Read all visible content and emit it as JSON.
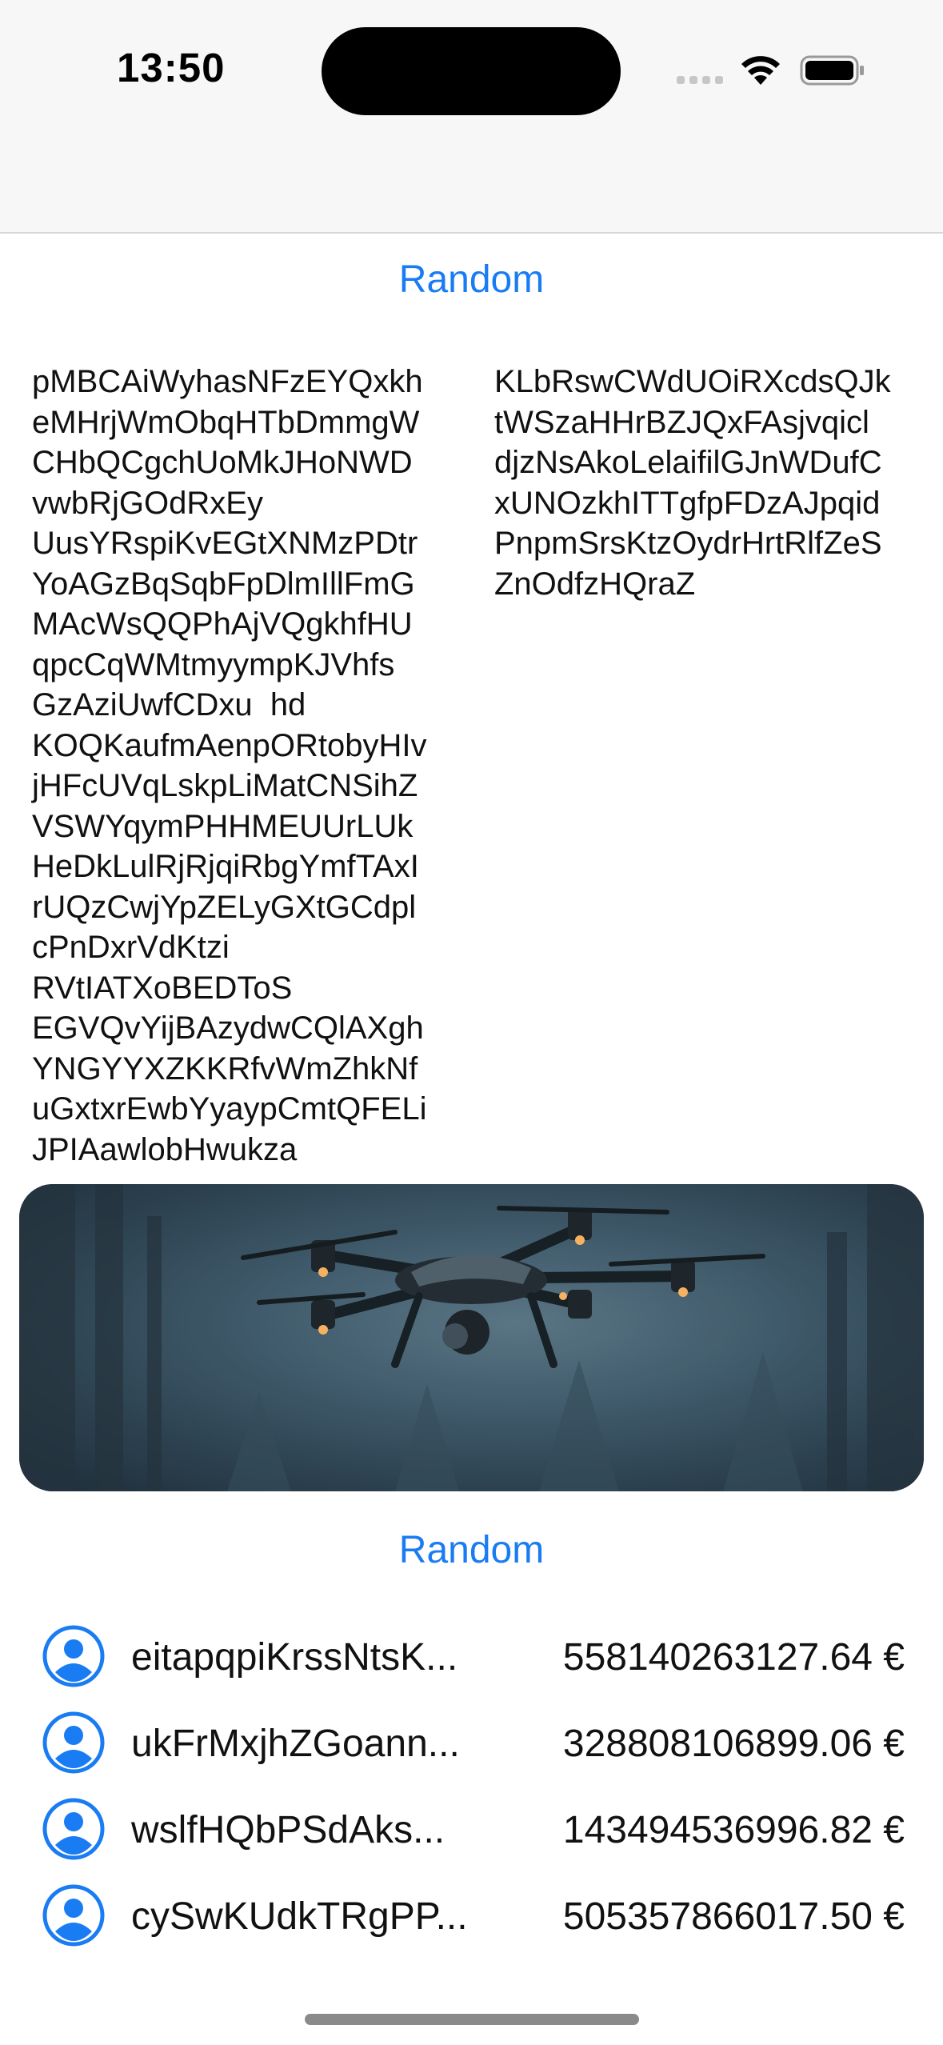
{
  "status_bar": {
    "time": "13:50"
  },
  "buttons": {
    "top_random": "Random",
    "bottom_random": "Random"
  },
  "text_columns": {
    "left": "pMBCAiWyhasNFzEYQxkh\neMHrjWmObqHTbDmmgW\nCHbQCgchUoMkJHoNWD\nvwbRjGOdRxEy\nUusYRspiKvEGtXNMzPDtr\nYoAGzBqSqbFpDlmIllFmG\nMAcWsQQPhAjVQgkhfHU\nqpcCqWMtmyympKJVhfs\nGzAziUwfCDxu  hd\nKOQKaufmAenpORtobyHIv\njHFcUVqLskpLiMatCNSihZ\nVSWYqymPHHMEUUrLUk\nHeDkLulRjRjqiRbgYmfTAxI\nrUQzCwjYpZELyGXtGCdpl\ncPnDxrVdKtzi\nRVtIATXoBEDToS\nEGVQvYijBAzydwCQlAXgh\nYNGYYXZKKRfvWmZhkNf\nuGxtxrEwbYyaypCmtQFELi\nJPIAawlobHwukza",
    "right": "KLbRswCWdUOiRXcdsQJk\ntWSzaHHrBZJQxFAsjvqicl\ndjzNsAkoLelaifilGJnWDufC\nxUNOzkhITTgfpFDzAJpqid\nPnpmSrsKtzOydrHrtRlfZeS\nZnOdfzHQraZ"
  },
  "hero_image": {
    "subject": "drone flying in foggy forest"
  },
  "list": [
    {
      "name": "eitapqpiKrssNtsK...",
      "amount": "558140263127.64 €"
    },
    {
      "name": "ukFrMxjhZGoann...",
      "amount": "328808106899.06 €"
    },
    {
      "name": "wslfHQbPSdAks...",
      "amount": "143494536996.82 €"
    },
    {
      "name": "cySwKUdkTRgPP...",
      "amount": "505357866017.50 €"
    }
  ],
  "colors": {
    "accent": "#1a7cf2"
  },
  "icons": {
    "row_icon": "person-circle-icon"
  }
}
